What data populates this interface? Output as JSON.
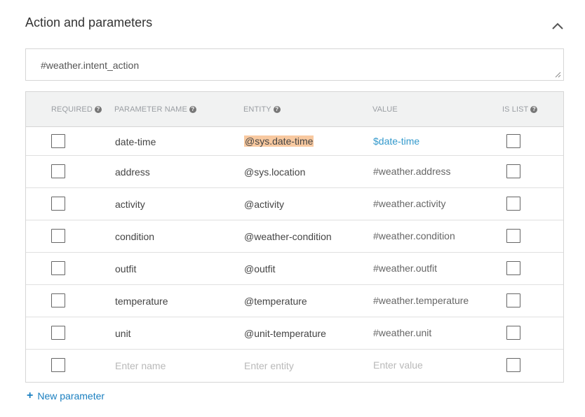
{
  "section": {
    "title": "Action and parameters"
  },
  "action": {
    "value": "#weather.intent_action"
  },
  "table": {
    "headers": {
      "required": "REQUIRED",
      "parameter_name": "PARAMETER NAME",
      "entity": "ENTITY",
      "value": "VALUE",
      "is_list": "IS LIST"
    },
    "rows": [
      {
        "name": "date-time",
        "entity": "@sys.date-time",
        "value": "$date-time",
        "required": false,
        "is_list": false
      },
      {
        "name": "address",
        "entity": "@sys.location",
        "value": "#weather.address",
        "required": false,
        "is_list": false
      },
      {
        "name": "activity",
        "entity": "@activity",
        "value": "#weather.activity",
        "required": false,
        "is_list": false
      },
      {
        "name": "condition",
        "entity": "@weather-condition",
        "value": "#weather.condition",
        "required": false,
        "is_list": false
      },
      {
        "name": "outfit",
        "entity": "@outfit",
        "value": "#weather.outfit",
        "required": false,
        "is_list": false
      },
      {
        "name": "temperature",
        "entity": "@temperature",
        "value": "#weather.temperature",
        "required": false,
        "is_list": false
      },
      {
        "name": "unit",
        "entity": "@unit-temperature",
        "value": "#weather.unit",
        "required": false,
        "is_list": false
      }
    ],
    "new_row": {
      "name_placeholder": "Enter name",
      "entity_placeholder": "Enter entity",
      "value_placeholder": "Enter value"
    }
  },
  "new_parameter": {
    "plus": "+",
    "label": "New parameter"
  },
  "colors": {
    "link": "#1a7fc0",
    "entity_highlight": "#f8c9a0",
    "value_link": "#3399cc"
  }
}
